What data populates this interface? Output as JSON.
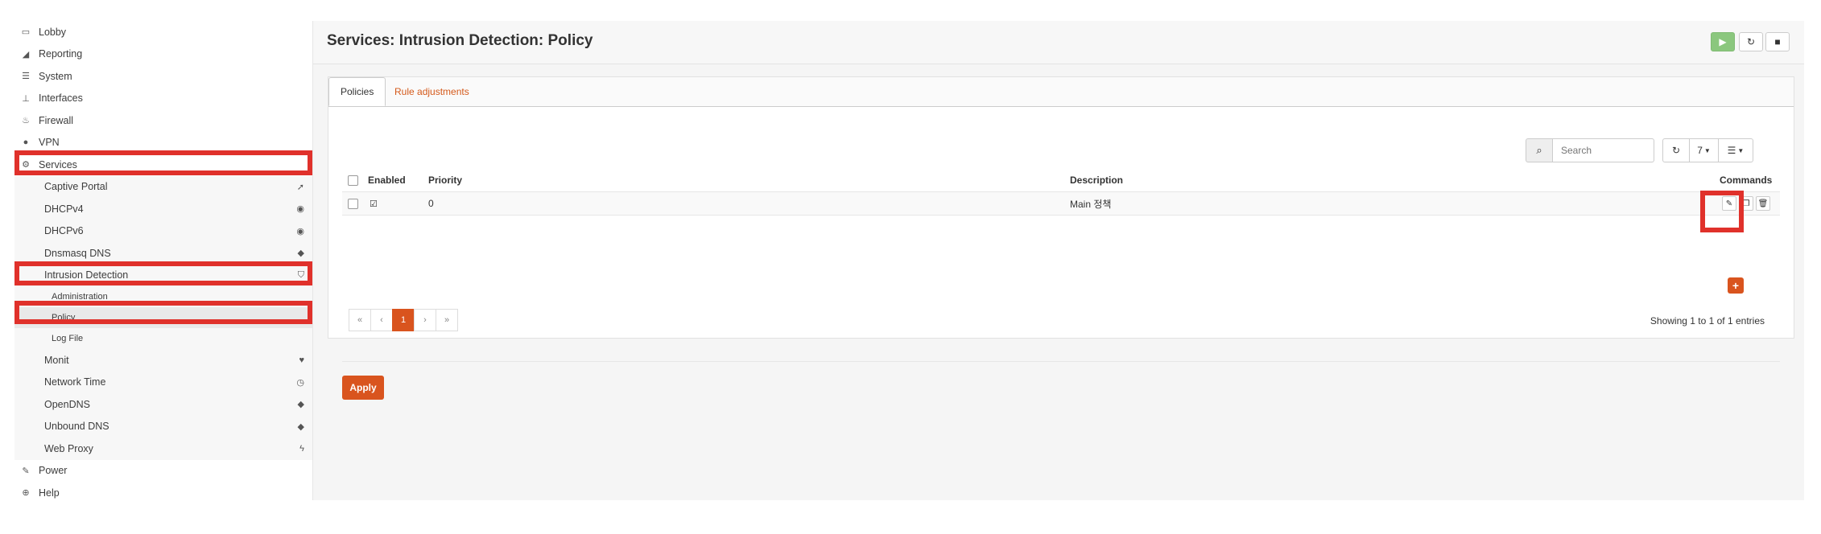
{
  "nav": {
    "lobby": "Lobby",
    "reporting": "Reporting",
    "system": "System",
    "interfaces": "Interfaces",
    "firewall": "Firewall",
    "vpn": "VPN",
    "services": "Services",
    "captive_portal": "Captive Portal",
    "dhcpv4": "DHCPv4",
    "dhcpv6": "DHCPv6",
    "dnsmasq": "Dnsmasq DNS",
    "intrusion": "Intrusion Detection",
    "administration": "Administration",
    "policy": "Policy",
    "logfile": "Log File",
    "monit": "Monit",
    "network_time": "Network Time",
    "opendns": "OpenDNS",
    "unbound": "Unbound DNS",
    "web_proxy": "Web Proxy",
    "power": "Power",
    "help": "Help"
  },
  "header": {
    "title": "Services: Intrusion Detection: Policy"
  },
  "tabs": {
    "policies": "Policies",
    "rule_adjustments": "Rule adjustments"
  },
  "toolbar": {
    "search_placeholder": "Search",
    "page_size": "7"
  },
  "grid": {
    "columns": {
      "enabled": "Enabled",
      "priority": "Priority",
      "description": "Description",
      "commands": "Commands"
    },
    "rows": [
      {
        "priority": "0",
        "description": "Main 정책"
      }
    ]
  },
  "pager": {
    "first": "«",
    "prev": "‹",
    "current": "1",
    "next": "›",
    "last": "»"
  },
  "info": "Showing 1 to 1 of 1 entries",
  "apply": "Apply",
  "colors": {
    "accent": "#d9541e",
    "highlight": "#e0312b",
    "play": "#8bc77e"
  }
}
